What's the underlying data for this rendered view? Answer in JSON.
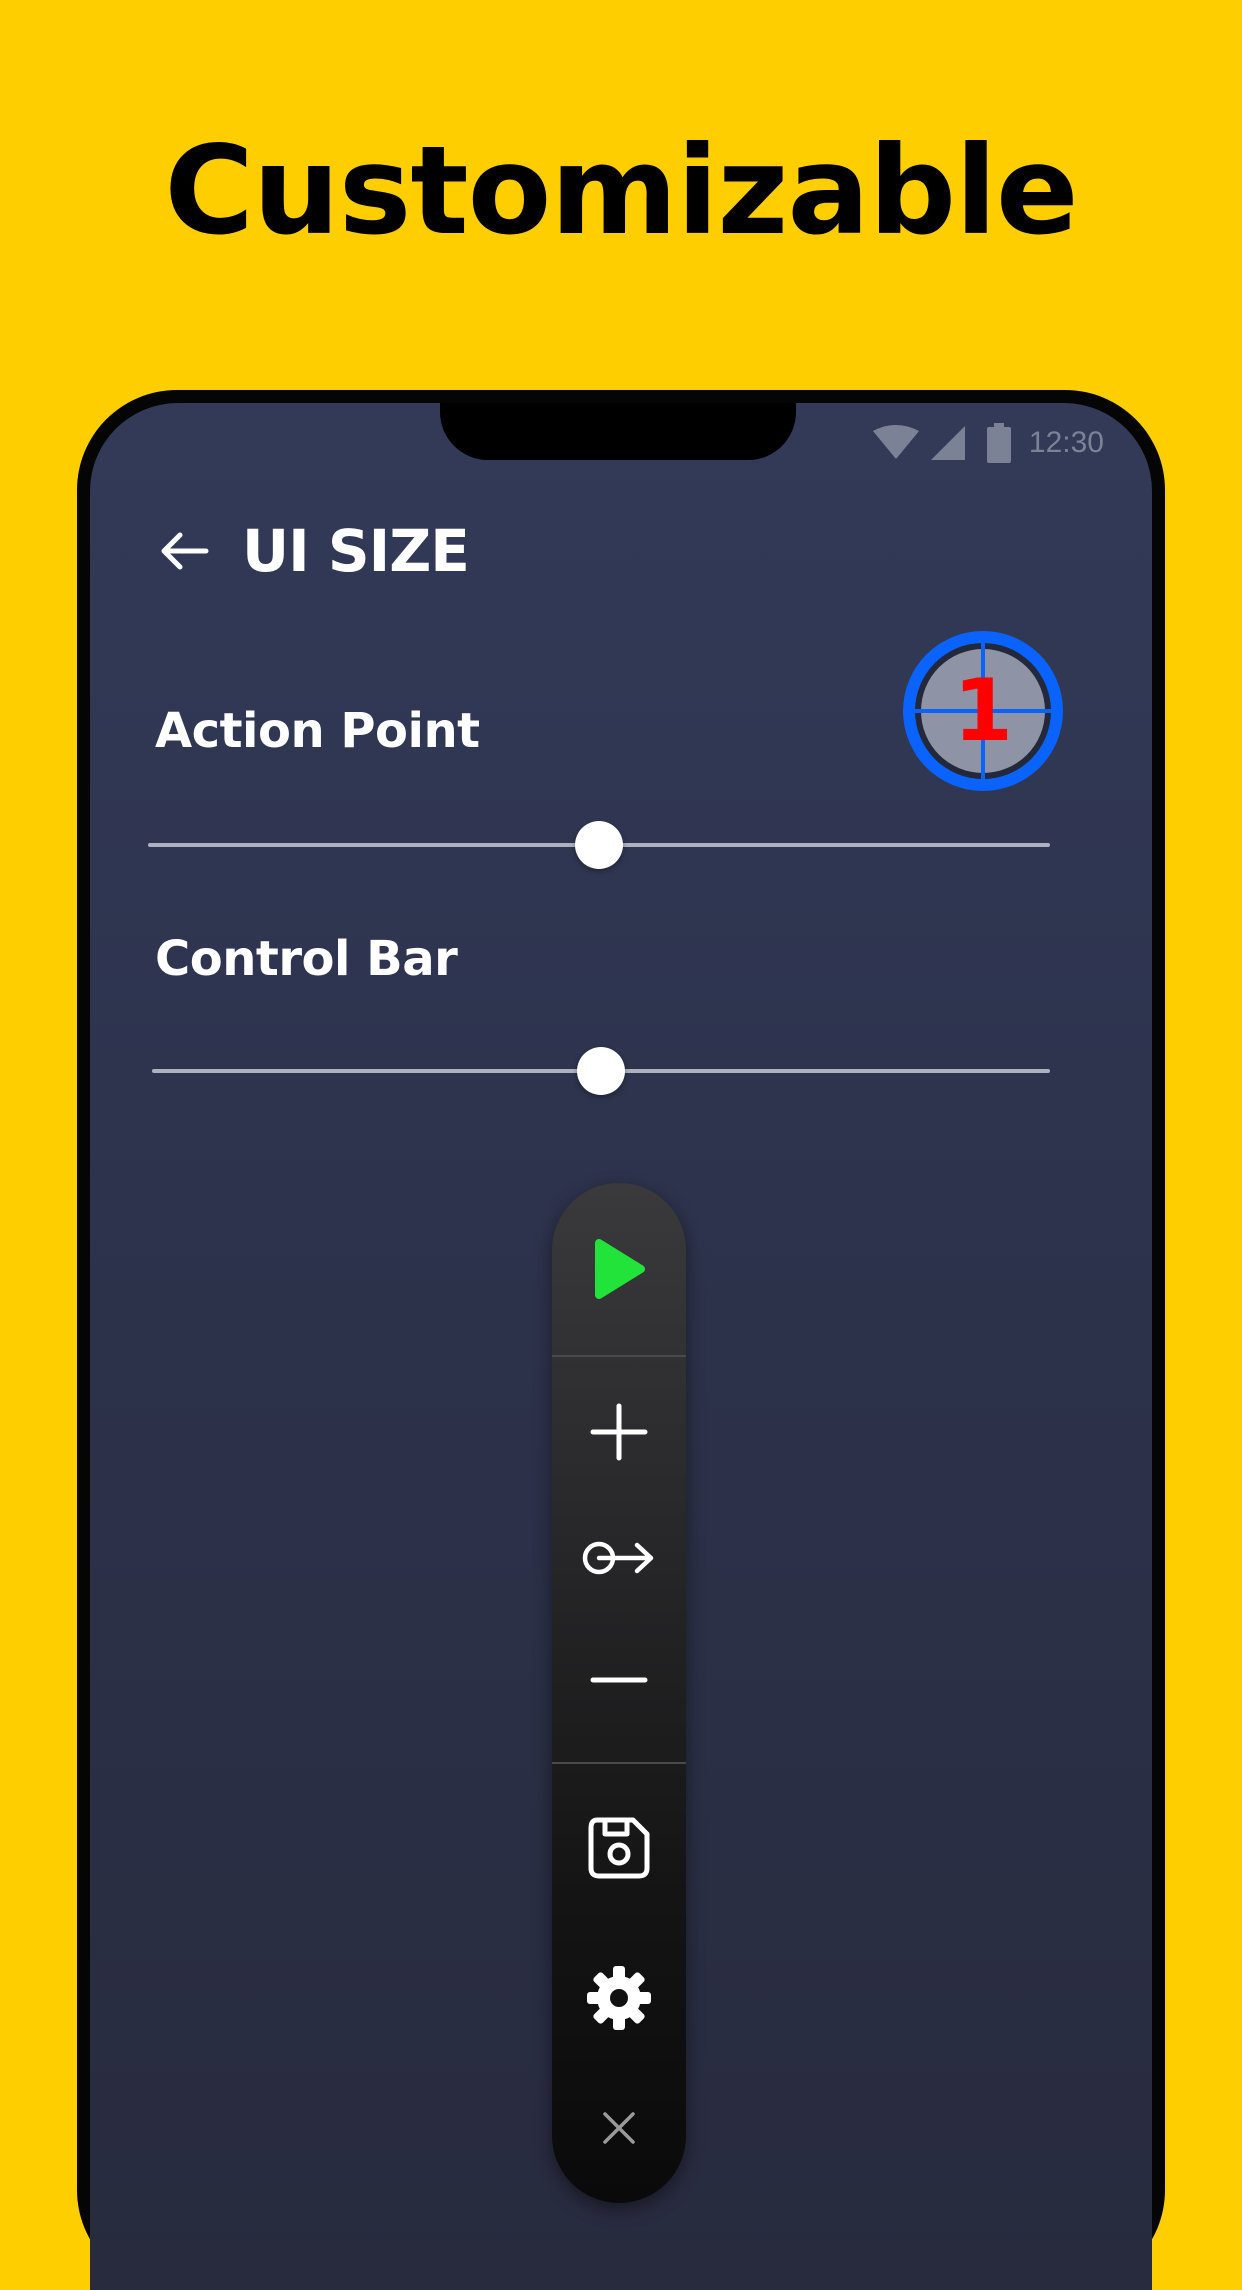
{
  "banner": {
    "headline": "Customizable"
  },
  "status_bar": {
    "time": "12:30"
  },
  "header": {
    "title": "UI SIZE"
  },
  "settings": [
    {
      "label": "Action Point",
      "value_percent": 50
    },
    {
      "label": "Control Bar",
      "value_percent": 50
    }
  ],
  "action_point_preview": {
    "number": "1",
    "ring_color": "#0a63ff",
    "fill_color": "#8e94a6",
    "number_color": "#ff0000"
  },
  "control_bar": {
    "buttons": [
      "play-icon",
      "plus-icon",
      "swipe-icon",
      "minus-icon",
      "save-icon",
      "gear-icon",
      "close-icon"
    ],
    "play_color": "#22e33a"
  },
  "colors": {
    "background": "#FFCE00",
    "screen": "#2f3552",
    "text": "#ffffff"
  }
}
